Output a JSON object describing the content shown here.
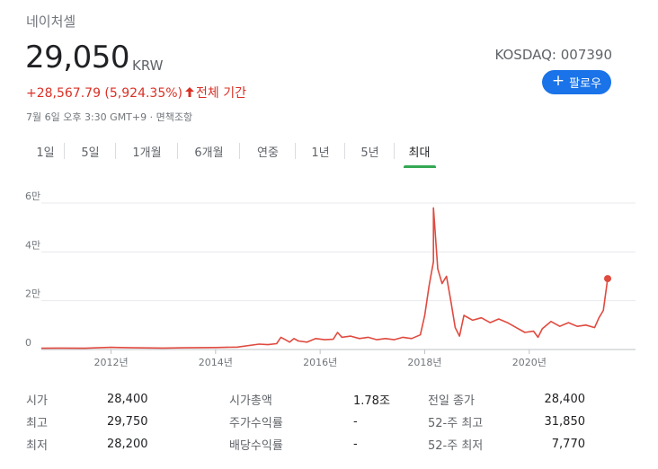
{
  "header": {
    "company": "네이처셀",
    "price": "29,050",
    "currency": "KRW",
    "exchange": "KOSDAQ: 007390",
    "change": "+28,567.79 (5,924.35%)",
    "change_arrow_icon": "arrow-up-icon",
    "change_period": "전체 기간",
    "timestamp": "7월 6일 오후 3:30 GMT+9 · 면책조항",
    "follow_label": "팔로우",
    "follow_icon": "plus-icon"
  },
  "tabs": [
    "1일",
    "5일",
    "1개월",
    "6개월",
    "연중",
    "1년",
    "5년",
    "최대"
  ],
  "selected_tab": "최대",
  "chart_data": {
    "type": "line",
    "title": "",
    "xlabel": "",
    "ylabel": "",
    "x_tick_labels": [
      "2012년",
      "2014년",
      "2016년",
      "2018년",
      "2020년"
    ],
    "y_tick_labels": [
      "0",
      "2만",
      "4만",
      "6만"
    ],
    "ylim": [
      0,
      60000
    ],
    "xlim": [
      "2010-09",
      "2021-07"
    ],
    "grid": "horizontal",
    "color": "#e04a3f",
    "series": [
      {
        "x": [
          "2010-09",
          "2011-01",
          "2011-07",
          "2012-01",
          "2012-06",
          "2013-01",
          "2013-06",
          "2014-01",
          "2014-06",
          "2014-11",
          "2015-01",
          "2015-03",
          "2015-04",
          "2015-05",
          "2015-06",
          "2015-07",
          "2015-08",
          "2015-10",
          "2015-12",
          "2016-02",
          "2016-04",
          "2016-05",
          "2016-06",
          "2016-08",
          "2016-10",
          "2016-12",
          "2017-02",
          "2017-04",
          "2017-06",
          "2017-08",
          "2017-10",
          "2017-12",
          "2018-01",
          "2018-02",
          "2018-03",
          "2018-03",
          "2018-04",
          "2018-05",
          "2018-06",
          "2018-07",
          "2018-08",
          "2018-09",
          "2018-10",
          "2018-12",
          "2019-02",
          "2019-04",
          "2019-06",
          "2019-08",
          "2019-10",
          "2019-12",
          "2020-02",
          "2020-03",
          "2020-04",
          "2020-06",
          "2020-08",
          "2020-10",
          "2020-12",
          "2021-02",
          "2021-04",
          "2021-05",
          "2021-06",
          "2021-07"
        ],
        "y": [
          500,
          600,
          500,
          900,
          700,
          600,
          700,
          800,
          1000,
          2200,
          2000,
          2400,
          5000,
          4000,
          3000,
          4500,
          3500,
          3000,
          4500,
          4000,
          4200,
          7000,
          5000,
          5500,
          4500,
          5000,
          4000,
          4500,
          4000,
          5000,
          4500,
          6000,
          14000,
          26000,
          36000,
          58000,
          33000,
          27000,
          30000,
          20000,
          9000,
          5500,
          14000,
          12000,
          13000,
          11000,
          12500,
          11000,
          9000,
          7000,
          7500,
          5000,
          8500,
          11500,
          9500,
          11000,
          9500,
          10000,
          9000,
          13000,
          16000,
          29050
        ]
      }
    ]
  },
  "stats": [
    [
      {
        "label": "시가",
        "value": "28,400"
      },
      {
        "label": "시가총액",
        "value": "1.78조"
      },
      {
        "label": "전일 종가",
        "value": "28,400"
      }
    ],
    [
      {
        "label": "최고",
        "value": "29,750"
      },
      {
        "label": "주가수익률",
        "value": "-"
      },
      {
        "label": "52-주 최고",
        "value": "31,850"
      }
    ],
    [
      {
        "label": "최저",
        "value": "28,200"
      },
      {
        "label": "배당수익률",
        "value": "-"
      },
      {
        "label": "52-주 최저",
        "value": "7,770"
      }
    ]
  ]
}
